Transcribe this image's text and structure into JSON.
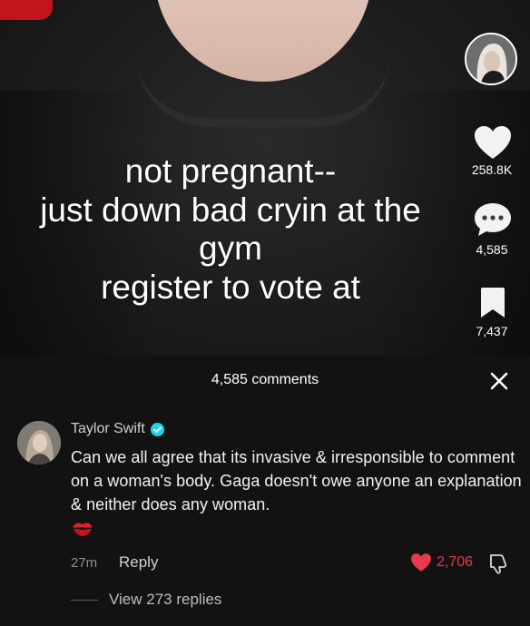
{
  "video": {
    "caption_lines": [
      "not pregnant--",
      "just down bad cryin at the",
      "gym",
      "register to vote at"
    ],
    "likes": "258.8K",
    "comments": "4,585",
    "saves": "7,437"
  },
  "comments_panel": {
    "title": "4,585 comments",
    "close_icon": "close-icon",
    "comment": {
      "author": "Taylor Swift",
      "verified": true,
      "text": "Can we all agree that its invasive & irresponsible to comment on a woman's body. Gaga doesn't owe anyone an explanation & neither does any woman.",
      "emoji": "kiss-mark",
      "time": "27m",
      "reply_label": "Reply",
      "likes": "2,706",
      "view_replies": "View 273 replies"
    }
  },
  "colors": {
    "panel_bg": "#121212",
    "like_red": "#e8394d",
    "verified": "#20d5ec"
  }
}
